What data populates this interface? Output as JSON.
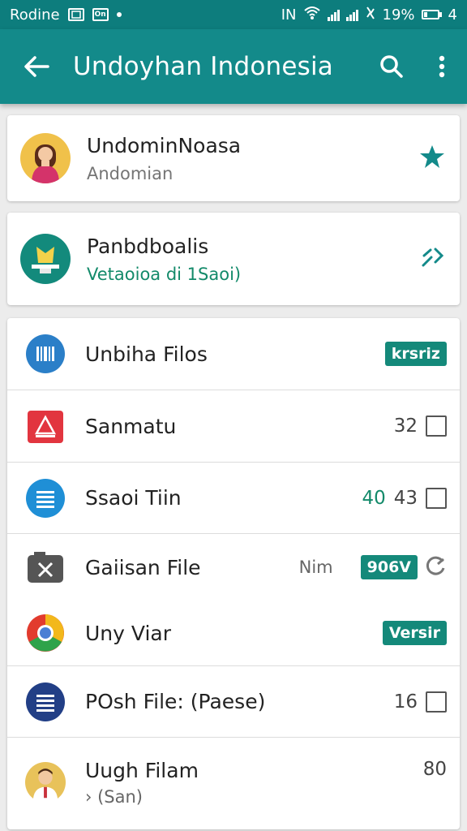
{
  "status_bar": {
    "left_text": "Rodine",
    "box_label": "On",
    "network": "IN",
    "battery_text": "19%",
    "extra": "4"
  },
  "app_bar": {
    "title": "Undoyhan Indonesia",
    "back_icon": "arrow-left-icon",
    "search_icon": "search-icon",
    "menu_icon": "more-vert-icon",
    "color": "#138a8a"
  },
  "cards": [
    {
      "title": "UndominNoasa",
      "subtitle": "Andomian",
      "action_icon": "star-icon"
    },
    {
      "title": "Panbdboalis",
      "subtitle": "Vetaoioa di 1Saoi)",
      "action_icon": "share-icon"
    }
  ],
  "list": {
    "items": [
      {
        "label": "Unbiha Filos",
        "badge": "krsriz"
      },
      {
        "label": "Sanmatu",
        "count": "32"
      },
      {
        "label": "Ssaoi Tiin",
        "count_a": "40",
        "count_b": "43"
      },
      {
        "label": "Gaiisan File",
        "meta": "Nim",
        "badge": "906V"
      },
      {
        "label": "Uny Viar",
        "badge": "Versir"
      },
      {
        "label": "POsh File: (Paese)",
        "count": "16"
      },
      {
        "label": "Uugh Filam",
        "sub": "(San)",
        "count": "80"
      }
    ]
  },
  "colors": {
    "accent": "#138a8a",
    "badge": "#14897a",
    "star": "#138a8a"
  }
}
